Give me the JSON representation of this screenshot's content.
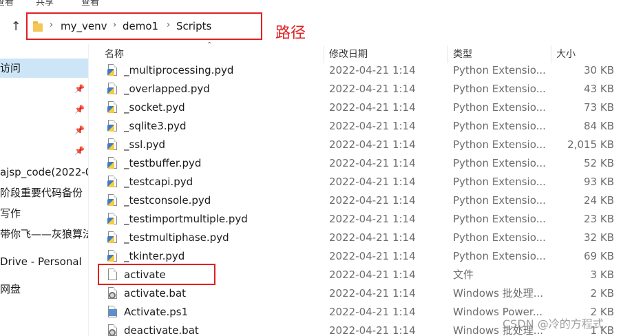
{
  "ribbon": {
    "items": [
      "查看",
      "共享",
      "查看"
    ]
  },
  "address_bar": {
    "segments": [
      "my_venv",
      "demo1",
      "Scripts"
    ]
  },
  "annotation": {
    "path_label": "路径"
  },
  "sidebar": {
    "items": [
      {
        "label": "访问",
        "selected": true,
        "pinned": false
      },
      {
        "label": "",
        "pinned": true
      },
      {
        "label": "",
        "pinned": true
      },
      {
        "label": "",
        "pinned": true
      },
      {
        "label": "",
        "pinned": true
      },
      {
        "label": "ajsp_code(2022-0",
        "pinned": false
      },
      {
        "label": "阶段重要代码备份",
        "pinned": false
      },
      {
        "label": "写作",
        "pinned": false
      },
      {
        "label": "带你飞——灰狼算法",
        "pinned": false
      },
      {
        "label": "Drive - Personal",
        "pinned": false
      },
      {
        "label": "网盘",
        "pinned": false
      },
      {
        "label": "",
        "pinned": false
      },
      {
        "label": "",
        "pinned": false
      }
    ]
  },
  "columns": {
    "name": "名称",
    "date": "修改日期",
    "type": "类型",
    "size": "大小"
  },
  "files": [
    {
      "name": "_multiprocessing.pyd",
      "date": "2022-04-21 1:14",
      "type": "Python Extensio...",
      "size": "30 KB",
      "icon": "python-file-icon"
    },
    {
      "name": "_overlapped.pyd",
      "date": "2022-04-21 1:14",
      "type": "Python Extensio...",
      "size": "43 KB",
      "icon": "python-file-icon"
    },
    {
      "name": "_socket.pyd",
      "date": "2022-04-21 1:14",
      "type": "Python Extensio...",
      "size": "73 KB",
      "icon": "python-file-icon"
    },
    {
      "name": "_sqlite3.pyd",
      "date": "2022-04-21 1:14",
      "type": "Python Extensio...",
      "size": "84 KB",
      "icon": "python-file-icon"
    },
    {
      "name": "_ssl.pyd",
      "date": "2022-04-21 1:14",
      "type": "Python Extensio...",
      "size": "2,015 KB",
      "icon": "python-file-icon"
    },
    {
      "name": "_testbuffer.pyd",
      "date": "2022-04-21 1:14",
      "type": "Python Extensio...",
      "size": "52 KB",
      "icon": "python-file-icon"
    },
    {
      "name": "_testcapi.pyd",
      "date": "2022-04-21 1:14",
      "type": "Python Extensio...",
      "size": "93 KB",
      "icon": "python-file-icon"
    },
    {
      "name": "_testconsole.pyd",
      "date": "2022-04-21 1:14",
      "type": "Python Extensio...",
      "size": "24 KB",
      "icon": "python-file-icon"
    },
    {
      "name": "_testimportmultiple.pyd",
      "date": "2022-04-21 1:14",
      "type": "Python Extensio...",
      "size": "23 KB",
      "icon": "python-file-icon"
    },
    {
      "name": "_testmultiphase.pyd",
      "date": "2022-04-21 1:14",
      "type": "Python Extensio...",
      "size": "32 KB",
      "icon": "python-file-icon"
    },
    {
      "name": "_tkinter.pyd",
      "date": "2022-04-21 1:14",
      "type": "Python Extensio...",
      "size": "69 KB",
      "icon": "python-file-icon"
    },
    {
      "name": "activate",
      "date": "2022-04-21 1:14",
      "type": "文件",
      "size": "3 KB",
      "icon": "blank-file-icon"
    },
    {
      "name": "activate.bat",
      "date": "2022-04-21 1:14",
      "type": "Windows 批处理...",
      "size": "2 KB",
      "icon": "batch-file-icon"
    },
    {
      "name": "Activate.ps1",
      "date": "2022-04-21 1:14",
      "type": "Windows Power...",
      "size": "2 KB",
      "icon": "powershell-file-icon"
    },
    {
      "name": "deactivate.bat",
      "date": "2022-04-21 1:14",
      "type": "Windows 批处理...",
      "size": "1 KB",
      "icon": "batch-file-icon"
    }
  ],
  "watermark": "CSDN @冷的方程式",
  "colors": {
    "annotation_red": "#e02020",
    "sidebar_selected": "#cde6f7",
    "python_blue": "#3f7cc5",
    "python_yellow": "#f5cc3e"
  }
}
